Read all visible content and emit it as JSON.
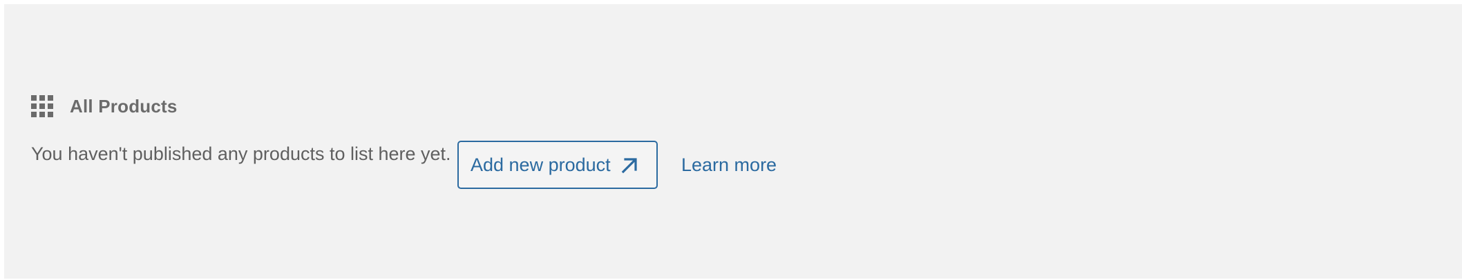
{
  "block": {
    "icon": "grid-icon",
    "title": "All Products",
    "empty_message": "You haven't published any products to list here yet.",
    "add_button_label": "Add new product",
    "add_button_icon": "external-arrow-icon",
    "learn_more_label": "Learn more"
  },
  "colors": {
    "panel_background": "#f2f2f2",
    "accent": "#2b6aa0",
    "muted_text": "#6b6b6b"
  }
}
